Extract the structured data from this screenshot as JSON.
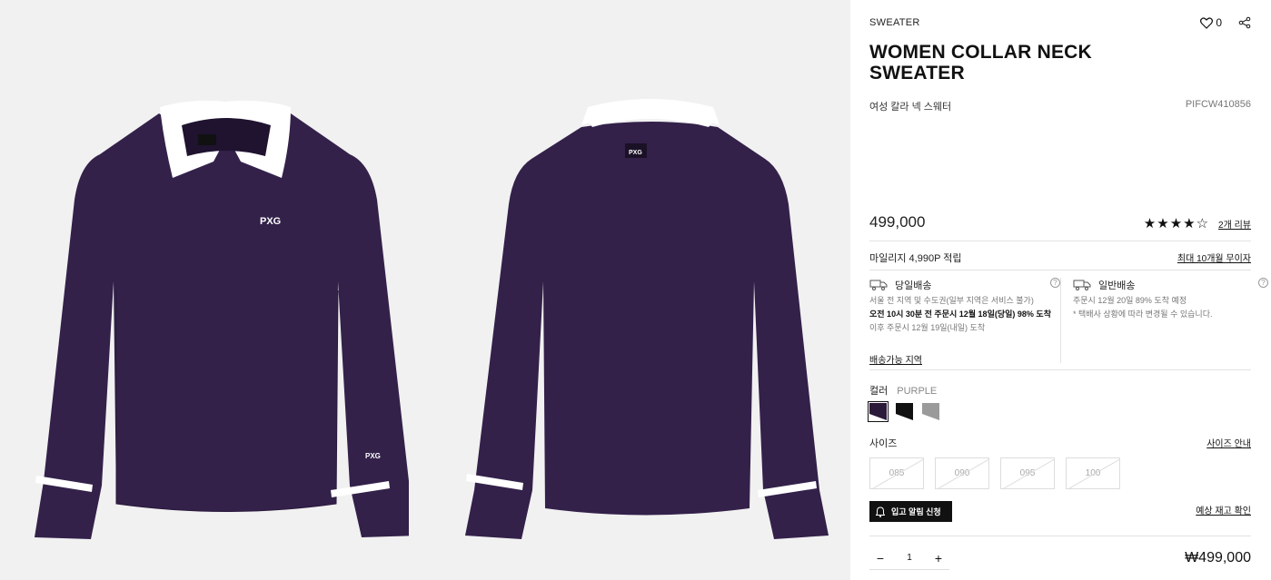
{
  "product": {
    "category": "SWEATER",
    "title": "WOMEN COLLAR NECK SWEATER",
    "korean_name": "여성 칼라 넥 스웨터",
    "code": "PIFCW410856",
    "wish_count": "0",
    "price": "499,000",
    "rating": 4.5,
    "stars": "★★★★☆",
    "review_link": "2개 리뷰",
    "logo_text": "PXG"
  },
  "mileage": {
    "text": "마일리지 4,990P 적립",
    "installment_link": "최대 10개월 무이자"
  },
  "shipping": {
    "same_day": {
      "title": "당일배송",
      "line1": "서울 전 지역 및 수도권(일부 지역은 서비스 불가)",
      "line2": "오전 10시 30분 전 주문시 12월 18일(당일) 98% 도착",
      "line3": "이후 주문시 12월 19일(내일) 도착",
      "area_link": "배송가능 지역"
    },
    "standard": {
      "title": "일반배송",
      "line1": "주문시 12월 20일 89% 도착 예정",
      "line2": "* 택배사 상황에 따라 변경될 수 있습니다."
    }
  },
  "color": {
    "label": "컬러",
    "selected": "PURPLE",
    "swatches": [
      "#2c1a3b",
      "#111111",
      "#9a9a9a"
    ]
  },
  "size": {
    "label": "사이즈",
    "guide_link": "사이즈 안내",
    "options": [
      "085",
      "090",
      "095",
      "100"
    ]
  },
  "restock": {
    "button": "입고 알림 신청",
    "expected_link": "예상 재고 확인"
  },
  "order": {
    "quantity": "1",
    "minus": "−",
    "plus": "+",
    "total": "₩499,000"
  },
  "colors": {
    "garment": "#33214a",
    "garment_dark": "#281a3b",
    "collar": "#ffffff",
    "gallery_bg": "#f1f1f1"
  }
}
